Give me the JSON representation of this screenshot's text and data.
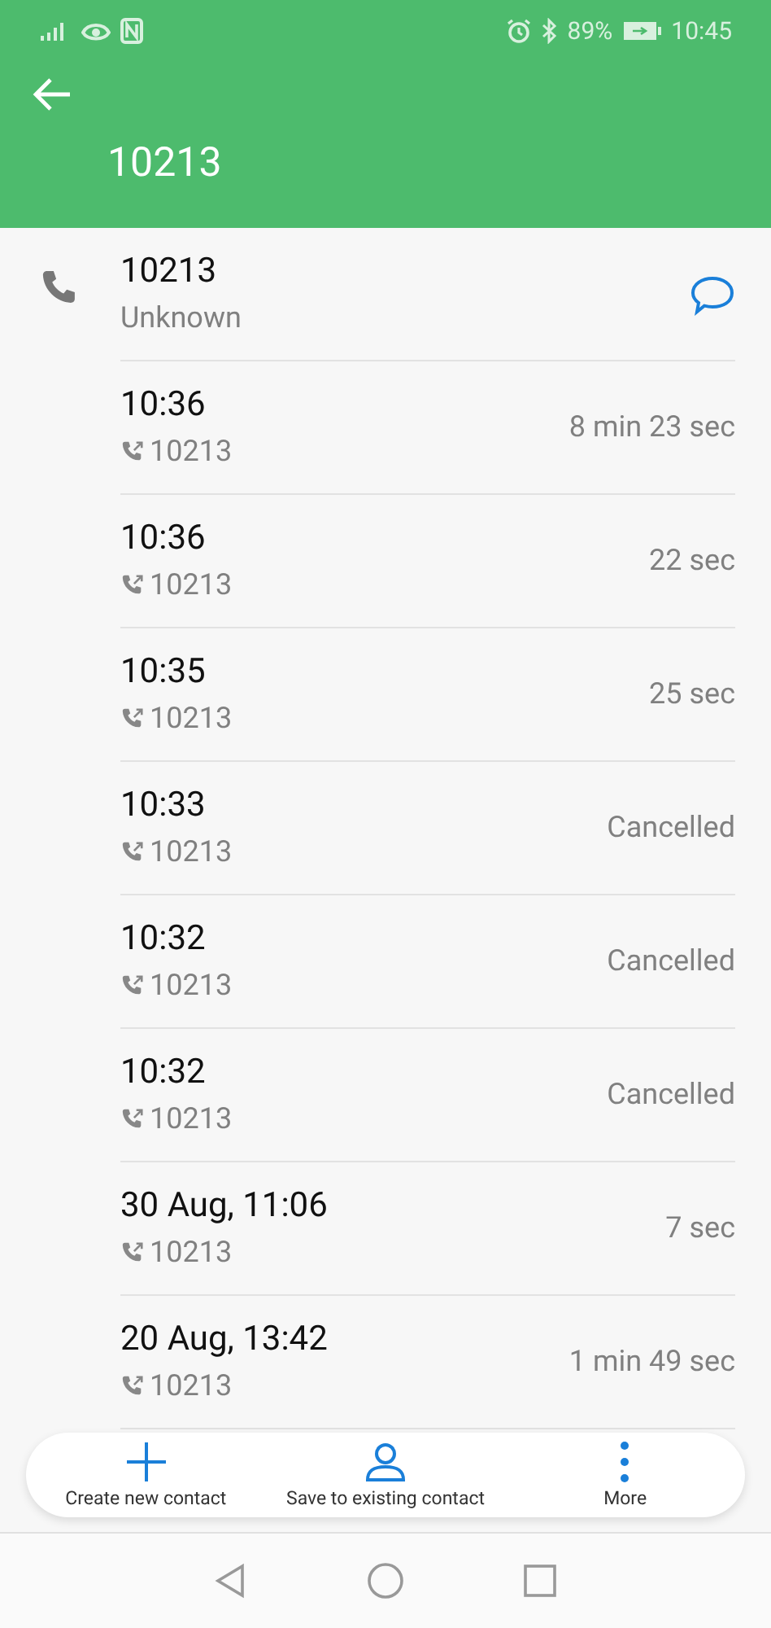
{
  "status_bar": {
    "battery": "89%",
    "time": "10:45"
  },
  "header": {
    "title": "10213"
  },
  "contact": {
    "number": "10213",
    "label": "Unknown"
  },
  "calls": [
    {
      "time": "10:36",
      "number": "10213",
      "duration": "8 min 23 sec"
    },
    {
      "time": "10:36",
      "number": "10213",
      "duration": "22 sec"
    },
    {
      "time": "10:35",
      "number": "10213",
      "duration": "25 sec"
    },
    {
      "time": "10:33",
      "number": "10213",
      "duration": "Cancelled"
    },
    {
      "time": "10:32",
      "number": "10213",
      "duration": "Cancelled"
    },
    {
      "time": "10:32",
      "number": "10213",
      "duration": "Cancelled"
    },
    {
      "time": "30 Aug, 11:06",
      "number": "10213",
      "duration": "7 sec"
    },
    {
      "time": "20 Aug, 13:42",
      "number": "10213",
      "duration": "1 min 49 sec"
    }
  ],
  "actions": [
    {
      "kind": "add",
      "label": "Create new contact"
    },
    {
      "kind": "person",
      "label": "Save to existing contact"
    },
    {
      "kind": "more",
      "label": "More"
    }
  ]
}
